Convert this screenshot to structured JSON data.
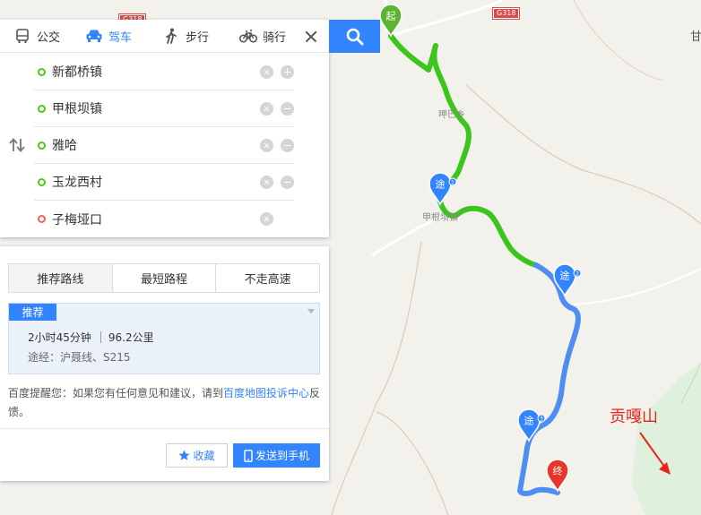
{
  "modes": [
    {
      "label": "公交",
      "icon": "bus-icon"
    },
    {
      "label": "驾车",
      "icon": "car-icon"
    },
    {
      "label": "步行",
      "icon": "walk-icon"
    },
    {
      "label": "骑行",
      "icon": "bike-icon"
    }
  ],
  "active_mode": "驾车",
  "waypoints": [
    {
      "name": "新都桥镇",
      "type": "start",
      "actions": [
        "delete",
        "add"
      ]
    },
    {
      "name": "甲根坝镇",
      "type": "via",
      "actions": [
        "delete",
        "remove"
      ]
    },
    {
      "name": "雅哈",
      "type": "via",
      "actions": [
        "delete",
        "remove"
      ]
    },
    {
      "name": "玉龙西村",
      "type": "via",
      "actions": [
        "delete",
        "remove"
      ]
    },
    {
      "name": "子梅垭口",
      "type": "end",
      "actions": [
        "delete"
      ]
    }
  ],
  "preference_tabs": [
    "推荐路线",
    "最短路程",
    "不走高速"
  ],
  "route": {
    "badge": "推荐",
    "duration": "2小时45分钟",
    "distance": "96.2公里",
    "via": "途经：沪聂线、S215"
  },
  "tip": {
    "prefix": "百度提醒您：如果您有任何意见和建议，请到",
    "link": "百度地图投诉中心",
    "suffix": "反馈。"
  },
  "buttons": {
    "favorite": "收藏",
    "send": "发送到手机"
  },
  "map": {
    "road_shields": [
      "G318",
      "G318"
    ],
    "places": [
      "呷巴乡",
      "甲根坝镇"
    ],
    "markers": [
      {
        "text": "起",
        "color": "#5cb531"
      },
      {
        "text": "途",
        "num": "1",
        "color": "#3385ff"
      },
      {
        "text": "途",
        "num": "2",
        "color": "#3385ff"
      },
      {
        "text": "途",
        "num": "3",
        "color": "#3385ff"
      },
      {
        "text": "终",
        "color": "#e8352b"
      }
    ],
    "annotation": "贡嘎山",
    "corner_text": "甘",
    "route_colors": {
      "clear": "#3cc51c",
      "normal": "#4d8ef0"
    }
  }
}
